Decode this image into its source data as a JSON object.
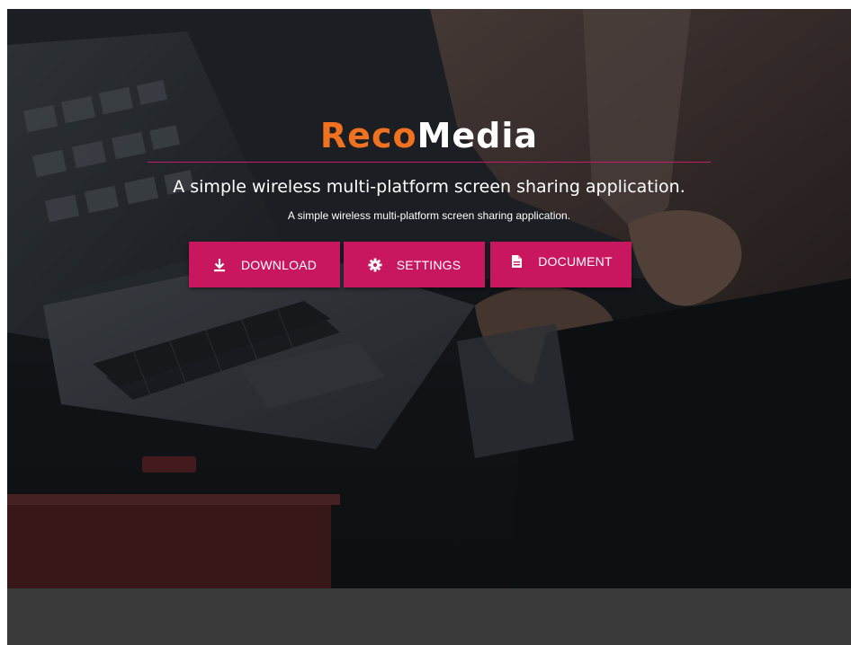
{
  "brand": {
    "part1": "Reco",
    "part2": "Media",
    "accent_color": "#f0711f",
    "rule_color": "#c31b66"
  },
  "hero": {
    "tagline": "A simple wireless multi-platform screen sharing application.",
    "subtagline": "A simple wireless multi-platform screen sharing application."
  },
  "buttons": {
    "color": "#c8175f",
    "download": {
      "label": "DOWNLOAD",
      "icon": "download-icon"
    },
    "settings": {
      "label": "SETTINGS",
      "icon": "gear-icon"
    },
    "document": {
      "label": "DOCUMENT",
      "icon": "document-icon"
    }
  }
}
